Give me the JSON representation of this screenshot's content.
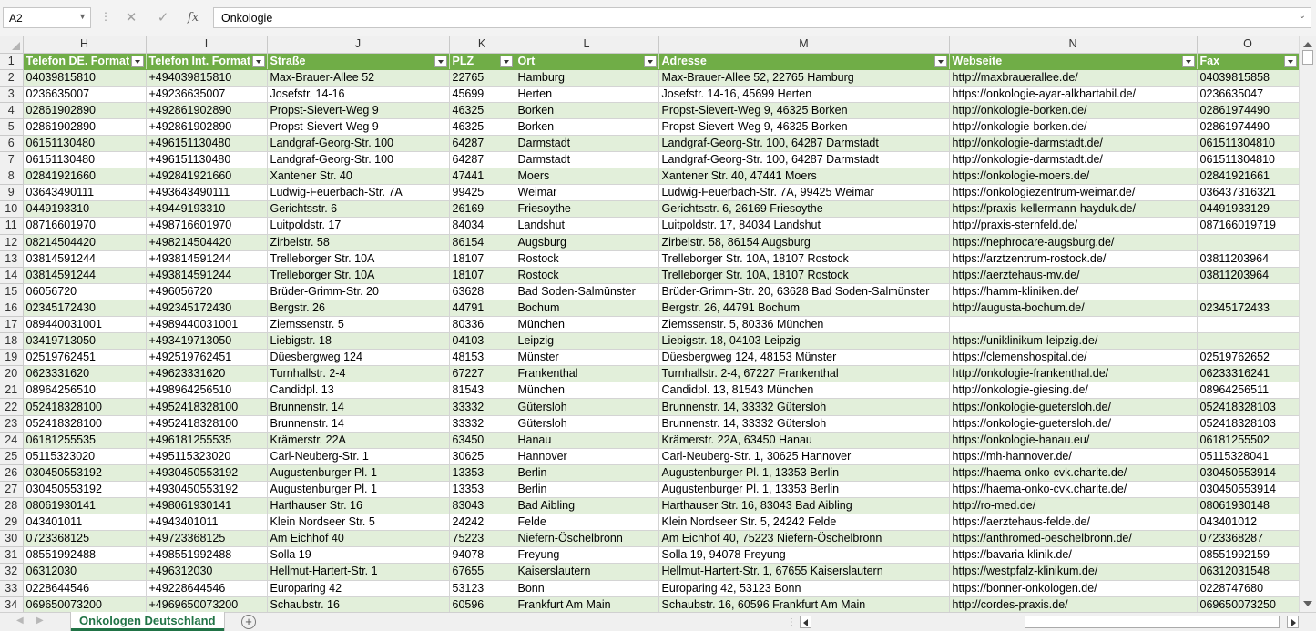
{
  "formula_bar": {
    "name_box": "A2",
    "separator": "⋮",
    "cancel_icon": "cancel-icon",
    "enter_icon": "check-icon",
    "fx_label": "fx",
    "content": "Onkologie"
  },
  "column_letters": [
    "H",
    "I",
    "J",
    "K",
    "L",
    "M",
    "N",
    "O"
  ],
  "header_row": {
    "row": "1",
    "cells": [
      "Telefon DE. Format",
      "Telefon Int. Format",
      "Straße",
      "PLZ",
      "Ort",
      "Adresse",
      "Webseite",
      "Fax"
    ]
  },
  "rows": [
    {
      "n": "2",
      "c": [
        "04039815810",
        "+494039815810",
        "Max-Brauer-Allee 52",
        "22765",
        "Hamburg",
        "Max-Brauer-Allee 52, 22765 Hamburg",
        "http://maxbrauerallee.de/",
        "04039815858"
      ]
    },
    {
      "n": "3",
      "c": [
        "0236635007",
        "+49236635007",
        "Josefstr. 14-16",
        "45699",
        "Herten",
        "Josefstr. 14-16, 45699 Herten",
        "https://onkologie-ayar-alkhartabil.de/",
        "0236635047"
      ]
    },
    {
      "n": "4",
      "c": [
        "02861902890",
        "+492861902890",
        "Propst-Sievert-Weg 9",
        "46325",
        "Borken",
        "Propst-Sievert-Weg 9, 46325 Borken",
        "http://onkologie-borken.de/",
        "02861974490"
      ]
    },
    {
      "n": "5",
      "c": [
        "02861902890",
        "+492861902890",
        "Propst-Sievert-Weg 9",
        "46325",
        "Borken",
        "Propst-Sievert-Weg 9, 46325 Borken",
        "http://onkologie-borken.de/",
        "02861974490"
      ]
    },
    {
      "n": "6",
      "c": [
        "06151130480",
        "+496151130480",
        "Landgraf-Georg-Str. 100",
        "64287",
        "Darmstadt",
        "Landgraf-Georg-Str. 100, 64287 Darmstadt",
        "http://onkologie-darmstadt.de/",
        "061511304810"
      ]
    },
    {
      "n": "7",
      "c": [
        "06151130480",
        "+496151130480",
        "Landgraf-Georg-Str. 100",
        "64287",
        "Darmstadt",
        "Landgraf-Georg-Str. 100, 64287 Darmstadt",
        "http://onkologie-darmstadt.de/",
        "061511304810"
      ]
    },
    {
      "n": "8",
      "c": [
        "02841921660",
        "+492841921660",
        "Xantener Str. 40",
        "47441",
        "Moers",
        "Xantener Str. 40, 47441 Moers",
        "https://onkologie-moers.de/",
        "02841921661"
      ]
    },
    {
      "n": "9",
      "c": [
        "03643490111",
        "+493643490111",
        "Ludwig-Feuerbach-Str. 7A",
        "99425",
        "Weimar",
        "Ludwig-Feuerbach-Str. 7A, 99425 Weimar",
        "https://onkologiezentrum-weimar.de/",
        "036437316321"
      ]
    },
    {
      "n": "10",
      "c": [
        "0449193310",
        "+49449193310",
        "Gerichtsstr. 6",
        "26169",
        "Friesoythe",
        "Gerichtsstr. 6, 26169 Friesoythe",
        "https://praxis-kellermann-hayduk.de/",
        "04491933129"
      ]
    },
    {
      "n": "11",
      "c": [
        "08716601970",
        "+498716601970",
        "Luitpoldstr. 17",
        "84034",
        "Landshut",
        "Luitpoldstr. 17, 84034 Landshut",
        "http://praxis-sternfeld.de/",
        "087166019719"
      ]
    },
    {
      "n": "12",
      "c": [
        "08214504420",
        "+498214504420",
        "Zirbelstr. 58",
        "86154",
        "Augsburg",
        "Zirbelstr. 58, 86154 Augsburg",
        "https://nephrocare-augsburg.de/",
        ""
      ]
    },
    {
      "n": "13",
      "c": [
        "03814591244",
        "+493814591244",
        "Trelleborger Str. 10A",
        "18107",
        "Rostock",
        "Trelleborger Str. 10A, 18107 Rostock",
        "https://arztzentrum-rostock.de/",
        "03811203964"
      ]
    },
    {
      "n": "14",
      "c": [
        "03814591244",
        "+493814591244",
        "Trelleborger Str. 10A",
        "18107",
        "Rostock",
        "Trelleborger Str. 10A, 18107 Rostock",
        "https://aerztehaus-mv.de/",
        "03811203964"
      ]
    },
    {
      "n": "15",
      "c": [
        "06056720",
        "+496056720",
        "Brüder-Grimm-Str. 20",
        "63628",
        "Bad Soden-Salmünster",
        "Brüder-Grimm-Str. 20, 63628 Bad Soden-Salmünster",
        "https://hamm-kliniken.de/",
        ""
      ]
    },
    {
      "n": "16",
      "c": [
        "02345172430",
        "+492345172430",
        "Bergstr. 26",
        "44791",
        "Bochum",
        "Bergstr. 26, 44791 Bochum",
        "http://augusta-bochum.de/",
        "02345172433"
      ]
    },
    {
      "n": "17",
      "c": [
        "089440031001",
        "+4989440031001",
        "Ziemssenstr. 5",
        "80336",
        "München",
        "Ziemssenstr. 5, 80336 München",
        "",
        ""
      ]
    },
    {
      "n": "18",
      "c": [
        "03419713050",
        "+493419713050",
        "Liebigstr. 18",
        "04103",
        "Leipzig",
        "Liebigstr. 18, 04103 Leipzig",
        "https://uniklinikum-leipzig.de/",
        ""
      ]
    },
    {
      "n": "19",
      "c": [
        "02519762451",
        "+492519762451",
        "Düesbergweg 124",
        "48153",
        "Münster",
        "Düesbergweg 124, 48153 Münster",
        "https://clemenshospital.de/",
        "02519762652"
      ]
    },
    {
      "n": "20",
      "c": [
        "0623331620",
        "+49623331620",
        "Turnhallstr. 2-4",
        "67227",
        "Frankenthal",
        "Turnhallstr. 2-4, 67227 Frankenthal",
        "http://onkologie-frankenthal.de/",
        "06233316241"
      ]
    },
    {
      "n": "21",
      "c": [
        "08964256510",
        "+498964256510",
        "Candidpl. 13",
        "81543",
        "München",
        "Candidpl. 13, 81543 München",
        "http://onkologie-giesing.de/",
        "08964256511"
      ]
    },
    {
      "n": "22",
      "c": [
        "052418328100",
        "+4952418328100",
        "Brunnenstr. 14",
        "33332",
        "Gütersloh",
        "Brunnenstr. 14, 33332 Gütersloh",
        "https://onkologie-guetersloh.de/",
        "052418328103"
      ]
    },
    {
      "n": "23",
      "c": [
        "052418328100",
        "+4952418328100",
        "Brunnenstr. 14",
        "33332",
        "Gütersloh",
        "Brunnenstr. 14, 33332 Gütersloh",
        "https://onkologie-guetersloh.de/",
        "052418328103"
      ]
    },
    {
      "n": "24",
      "c": [
        "06181255535",
        "+496181255535",
        "Krämerstr. 22A",
        "63450",
        "Hanau",
        "Krämerstr. 22A, 63450 Hanau",
        "https://onkologie-hanau.eu/",
        "06181255502"
      ]
    },
    {
      "n": "25",
      "c": [
        "05115323020",
        "+495115323020",
        "Carl-Neuberg-Str. 1",
        "30625",
        "Hannover",
        "Carl-Neuberg-Str. 1, 30625 Hannover",
        "https://mh-hannover.de/",
        "05115328041"
      ]
    },
    {
      "n": "26",
      "c": [
        "030450553192",
        "+4930450553192",
        "Augustenburger Pl. 1",
        "13353",
        "Berlin",
        "Augustenburger Pl. 1, 13353 Berlin",
        "https://haema-onko-cvk.charite.de/",
        "030450553914"
      ]
    },
    {
      "n": "27",
      "c": [
        "030450553192",
        "+4930450553192",
        "Augustenburger Pl. 1",
        "13353",
        "Berlin",
        "Augustenburger Pl. 1, 13353 Berlin",
        "https://haema-onko-cvk.charite.de/",
        "030450553914"
      ]
    },
    {
      "n": "28",
      "c": [
        "08061930141",
        "+498061930141",
        "Harthauser Str. 16",
        "83043",
        "Bad Aibling",
        "Harthauser Str. 16, 83043 Bad Aibling",
        "http://ro-med.de/",
        "08061930148"
      ]
    },
    {
      "n": "29",
      "c": [
        "043401011",
        "+4943401011",
        "Klein Nordseer Str. 5",
        "24242",
        "Felde",
        "Klein Nordseer Str. 5, 24242 Felde",
        "https://aerztehaus-felde.de/",
        "043401012"
      ]
    },
    {
      "n": "30",
      "c": [
        "0723368125",
        "+49723368125",
        "Am Eichhof 40",
        "75223",
        "Niefern-Öschelbronn",
        "Am Eichhof 40, 75223 Niefern-Öschelbronn",
        "https://anthromed-oeschelbronn.de/",
        "0723368287"
      ]
    },
    {
      "n": "31",
      "c": [
        "08551992488",
        "+498551992488",
        "Solla 19",
        "94078",
        "Freyung",
        "Solla 19, 94078 Freyung",
        "https://bavaria-klinik.de/",
        "08551992159"
      ]
    },
    {
      "n": "32",
      "c": [
        "06312030",
        "+496312030",
        "Hellmut-Hartert-Str. 1",
        "67655",
        "Kaiserslautern",
        "Hellmut-Hartert-Str. 1, 67655 Kaiserslautern",
        "https://westpfalz-klinikum.de/",
        "06312031548"
      ]
    },
    {
      "n": "33",
      "c": [
        "0228644546",
        "+49228644546",
        "Europaring 42",
        "53123",
        "Bonn",
        "Europaring 42, 53123 Bonn",
        "https://bonner-onkologen.de/",
        "0228747680"
      ]
    },
    {
      "n": "34",
      "c": [
        "069650073200",
        "+4969650073200",
        "Schaubstr. 16",
        "60596",
        "Frankfurt Am Main",
        "Schaubstr. 16, 60596 Frankfurt Am Main",
        "http://cordes-praxis.de/",
        "069650073250"
      ]
    }
  ],
  "sheet_tabs": {
    "active": "Onkologen Deutschland",
    "add_label": "+"
  }
}
